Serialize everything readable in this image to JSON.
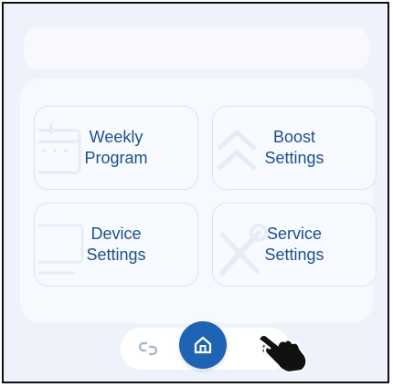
{
  "tiles": [
    {
      "label": "Weekly\nProgram",
      "icon": "calendar-icon"
    },
    {
      "label": "Boost\nSettings",
      "icon": "double-chevron-up-icon"
    },
    {
      "label": "Device\nSettings",
      "icon": "monitor-icon"
    },
    {
      "label": "Service\nSettings",
      "icon": "wrench-screwdriver-icon"
    }
  ],
  "nav": {
    "left_icon": "link-icon",
    "center_icon": "home-icon",
    "right_icon": "gear-icon"
  },
  "colors": {
    "accent": "#1f63b5",
    "tile_text": "#1f4f8a",
    "background": "#eef3fb"
  }
}
